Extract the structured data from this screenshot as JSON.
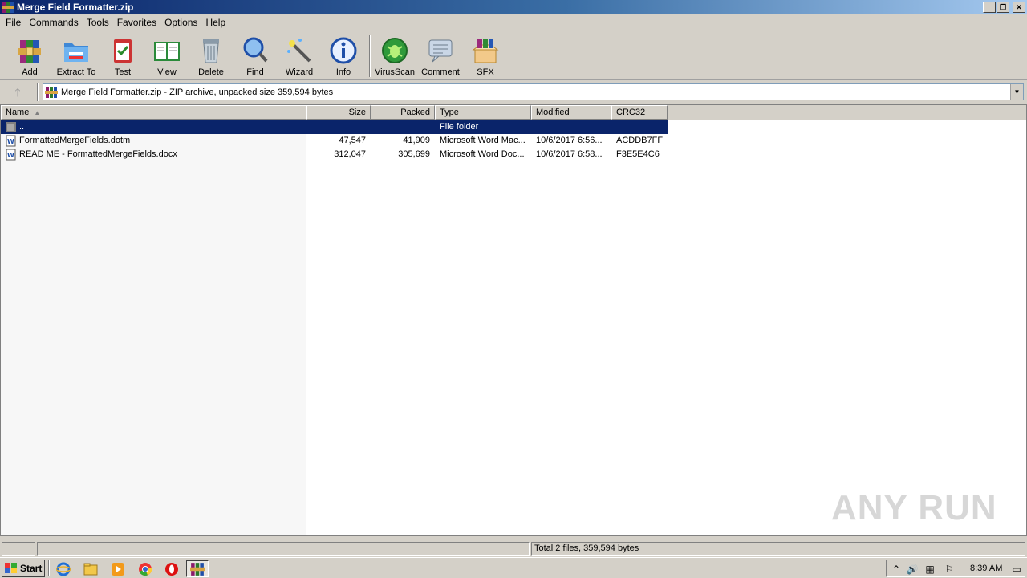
{
  "window": {
    "title": "Merge Field Formatter.zip"
  },
  "menu": [
    "File",
    "Commands",
    "Tools",
    "Favorites",
    "Options",
    "Help"
  ],
  "toolbar": {
    "add": "Add",
    "extract": "Extract To",
    "test": "Test",
    "view": "View",
    "delete": "Delete",
    "find": "Find",
    "wizard": "Wizard",
    "info": "Info",
    "virusscan": "VirusScan",
    "comment": "Comment",
    "sfx": "SFX"
  },
  "address": {
    "text": "Merge Field Formatter.zip - ZIP archive, unpacked size 359,594 bytes"
  },
  "columns": {
    "name": "Name",
    "size": "Size",
    "packed": "Packed",
    "type": "Type",
    "modified": "Modified",
    "crc": "CRC32"
  },
  "rows": [
    {
      "name": "..",
      "size": "",
      "packed": "",
      "type": "File folder",
      "modified": "",
      "crc": ""
    },
    {
      "name": "FormattedMergeFields.dotm",
      "size": "47,547",
      "packed": "41,909",
      "type": "Microsoft Word Mac...",
      "modified": "10/6/2017 6:56...",
      "crc": "ACDDB7FF"
    },
    {
      "name": "READ ME - FormattedMergeFields.docx",
      "size": "312,047",
      "packed": "305,699",
      "type": "Microsoft Word Doc...",
      "modified": "10/6/2017 6:58...",
      "crc": "F3E5E4C6"
    }
  ],
  "status": {
    "total": "Total 2 files, 359,594 bytes"
  },
  "taskbar": {
    "start": "Start",
    "clock": "8:39 AM"
  },
  "watermark": "ANY RUN",
  "colors": {
    "selection": "#0a246a",
    "titlebar": "#0a246a"
  }
}
